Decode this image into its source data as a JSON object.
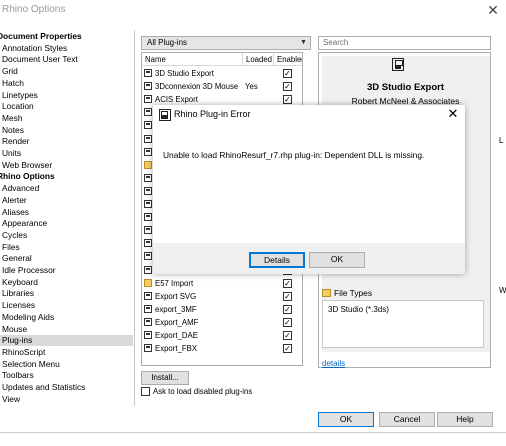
{
  "window": {
    "title": "Rhino Options",
    "close_glyph": "✕"
  },
  "tree": {
    "items": [
      {
        "label": "Document Properties",
        "group": true
      },
      {
        "label": "Annotation Styles"
      },
      {
        "label": "Document User Text"
      },
      {
        "label": "Grid"
      },
      {
        "label": "Hatch"
      },
      {
        "label": "Linetypes"
      },
      {
        "label": "Location"
      },
      {
        "label": "Mesh"
      },
      {
        "label": "Notes"
      },
      {
        "label": "Render"
      },
      {
        "label": "Units"
      },
      {
        "label": "Web Browser"
      },
      {
        "label": "Rhino Options",
        "group": true
      },
      {
        "label": "Advanced"
      },
      {
        "label": "Alerter"
      },
      {
        "label": "Aliases"
      },
      {
        "label": "Appearance"
      },
      {
        "label": "Cycles"
      },
      {
        "label": "Files"
      },
      {
        "label": "General"
      },
      {
        "label": "Idle Processor"
      },
      {
        "label": "Keyboard"
      },
      {
        "label": "Libraries"
      },
      {
        "label": "Licenses"
      },
      {
        "label": "Modeling Aids"
      },
      {
        "label": "Mouse"
      },
      {
        "label": "Plug-ins",
        "selected": true
      },
      {
        "label": "RhinoScript"
      },
      {
        "label": "Selection Menu"
      },
      {
        "label": "Toolbars"
      },
      {
        "label": "Updates and Statistics"
      },
      {
        "label": "View"
      }
    ]
  },
  "filter": {
    "value": "All Plug-ins",
    "arrow": "▼"
  },
  "search": {
    "placeholder": "Search"
  },
  "table": {
    "headers": {
      "name": "Name",
      "loaded": "Loaded",
      "enabled": "Enabled"
    },
    "rows": [
      {
        "name": "3D Studio Export",
        "loaded": "",
        "enabled": true,
        "icon": "plugin"
      },
      {
        "name": "3Dconnexion 3D Mouse",
        "loaded": "Yes",
        "enabled": true,
        "icon": "plugin"
      },
      {
        "name": "ACIS Export",
        "loaded": "",
        "enabled": true,
        "icon": "plugin"
      },
      {
        "name": "",
        "loaded": "",
        "enabled": true,
        "icon": "plugin"
      },
      {
        "name": "",
        "loaded": "",
        "enabled": true,
        "icon": "plugin"
      },
      {
        "name": "",
        "loaded": "",
        "enabled": true,
        "icon": "plugin"
      },
      {
        "name": "",
        "loaded": "",
        "enabled": true,
        "icon": "plugin"
      },
      {
        "name": "",
        "loaded": "",
        "enabled": true,
        "icon": "folder"
      },
      {
        "name": "",
        "loaded": "",
        "enabled": true,
        "icon": "plugin"
      },
      {
        "name": "",
        "loaded": "",
        "enabled": true,
        "icon": "plugin"
      },
      {
        "name": "",
        "loaded": "",
        "enabled": true,
        "icon": "plugin"
      },
      {
        "name": "",
        "loaded": "",
        "enabled": true,
        "icon": "plugin"
      },
      {
        "name": "",
        "loaded": "",
        "enabled": true,
        "icon": "plugin"
      },
      {
        "name": "",
        "loaded": "",
        "enabled": true,
        "icon": "plugin"
      },
      {
        "name": "",
        "loaded": "",
        "enabled": true,
        "icon": "plugin"
      },
      {
        "name": "",
        "loaded": "",
        "enabled": true,
        "icon": "plugin"
      },
      {
        "name": "E57 Import",
        "loaded": "",
        "enabled": true,
        "icon": "folder"
      },
      {
        "name": "Export SVG",
        "loaded": "",
        "enabled": true,
        "icon": "plugin"
      },
      {
        "name": "export_3MF",
        "loaded": "",
        "enabled": true,
        "icon": "plugin"
      },
      {
        "name": "Export_AMF",
        "loaded": "",
        "enabled": true,
        "icon": "plugin"
      },
      {
        "name": "Export_DAE",
        "loaded": "",
        "enabled": true,
        "icon": "plugin"
      },
      {
        "name": "Export_FBX",
        "loaded": "",
        "enabled": true,
        "icon": "plugin"
      }
    ]
  },
  "details": {
    "plugin_name": "3D Studio Export",
    "author": "Robert McNeel & Associates",
    "file_types_label": "File Types",
    "file_type_value": "3D Studio (*.3ds)",
    "details_link": "details",
    "edge_letter_top": "L",
    "edge_letter_bottom": "W"
  },
  "install_label": "Install...",
  "ask_label": "Ask to load disabled plug-ins",
  "buttons": {
    "ok": "OK",
    "cancel": "Cancel",
    "help": "Help"
  },
  "modal": {
    "title": "Rhino Plug-in Error",
    "close_glyph": "✕",
    "message": "Unable to load RhinoResurf_r7.rhp plug-in: Dependent DLL is missing.",
    "details_label": "Details",
    "ok_label": "OK"
  },
  "check_glyph": "✓"
}
